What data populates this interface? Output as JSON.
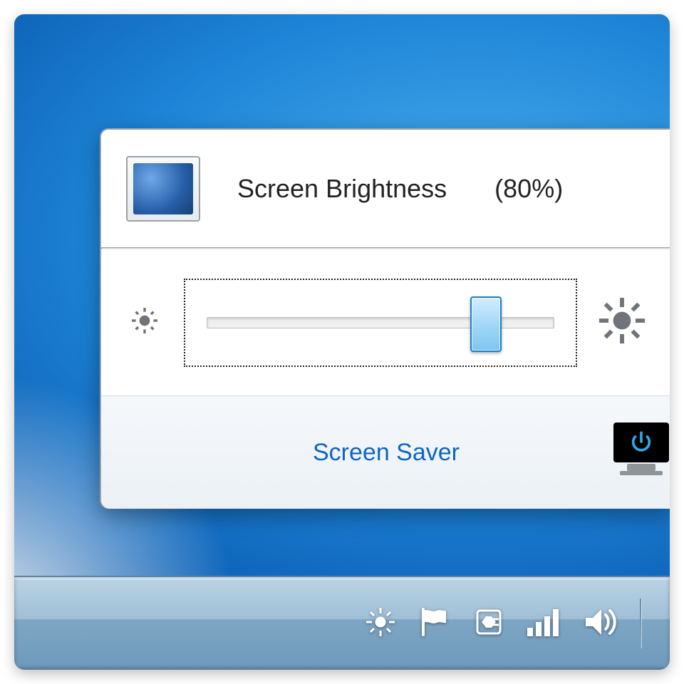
{
  "popup": {
    "title": "Screen Brightness",
    "percent_label": "(80%)",
    "brightness_percent": 80,
    "screen_saver_link": "Screen Saver"
  },
  "icons": {
    "app_badge": "brightness-monitor-icon",
    "slider_low": "brightness-low-icon",
    "slider_high": "brightness-high-icon",
    "power_monitor": "power-monitor-icon"
  },
  "tray": {
    "items": [
      "brightness-icon",
      "flag-icon",
      "power-plug-icon",
      "network-signal-icon",
      "volume-icon"
    ]
  }
}
